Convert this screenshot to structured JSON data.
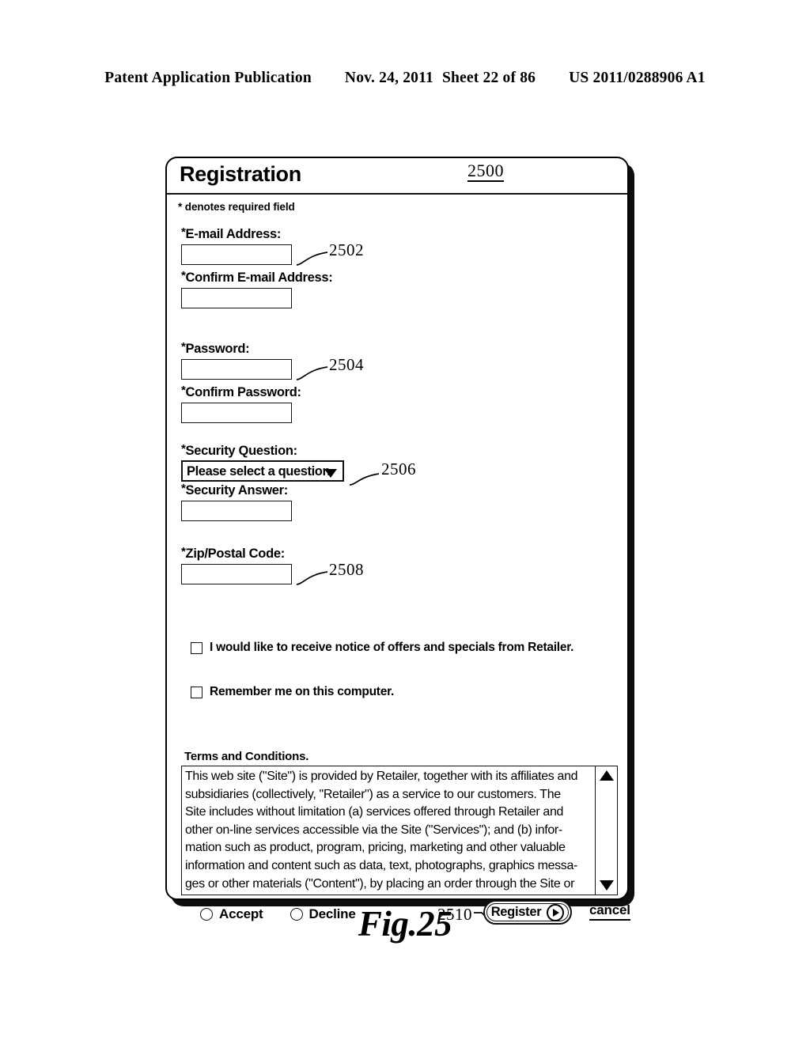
{
  "header": {
    "publication": "Patent Application Publication",
    "date": "Nov. 24, 2011",
    "sheet": "Sheet 22 of 86",
    "patent_number": "US 2011/0288906 A1"
  },
  "figure": {
    "caption": "Fig.25",
    "panel_ref": "2500"
  },
  "dialog": {
    "title": "Registration",
    "required_note": "* denotes required field",
    "fields": [
      {
        "label": "E-mail Address:",
        "star": "*",
        "type": "text",
        "value": "",
        "ref": "2502"
      },
      {
        "label": "Confirm E-mail Address:",
        "star": "*",
        "type": "text",
        "value": "",
        "ref": ""
      },
      {
        "label": "Password:",
        "star": "*",
        "type": "text",
        "value": "",
        "ref": "2504"
      },
      {
        "label": "Confirm Password:",
        "star": "*",
        "type": "text",
        "value": "",
        "ref": ""
      },
      {
        "label": "Security Question:",
        "star": "*",
        "type": "select",
        "value": "Please select a question.",
        "ref": "2506"
      },
      {
        "label": "Security Answer:",
        "star": "*",
        "type": "text",
        "value": "",
        "ref": ""
      },
      {
        "label": "Zip/Postal Code:",
        "star": "*",
        "type": "text",
        "value": "",
        "ref": "2508"
      }
    ],
    "checkboxes": [
      {
        "label": "I would like to receive notice of offers and specials from Retailer.",
        "checked": false
      },
      {
        "label": "Remember me on this computer.",
        "checked": false
      }
    ],
    "terms": {
      "heading": "Terms and Conditions.",
      "lines": [
        "This web site (\"Site\") is provided by Retailer, together with its affiliates and",
        "subsidiaries (collectively, \"Retailer\") as a service to our customers.  The",
        "Site includes without limitation (a) services offered through Retailer and",
        "other on-line services accessible via the Site (\"Services\"); and (b) infor-",
        "mation such as product, program, pricing, marketing and other valuable",
        "information and content such as data, text, photographs, graphics messa-",
        "ges or other materials (\"Content\"), by placing an order through the Site or"
      ],
      "scroll_up_icon": "triangle-up-icon",
      "scroll_down_icon": "triangle-down-icon"
    },
    "footer": {
      "radios": [
        {
          "label": "Accept",
          "selected": false
        },
        {
          "label": "Decline",
          "selected": false
        }
      ],
      "register_ref": "2510",
      "register_label": "Register",
      "register_icon": "play-circle-icon",
      "cancel_label": "cancel"
    }
  }
}
